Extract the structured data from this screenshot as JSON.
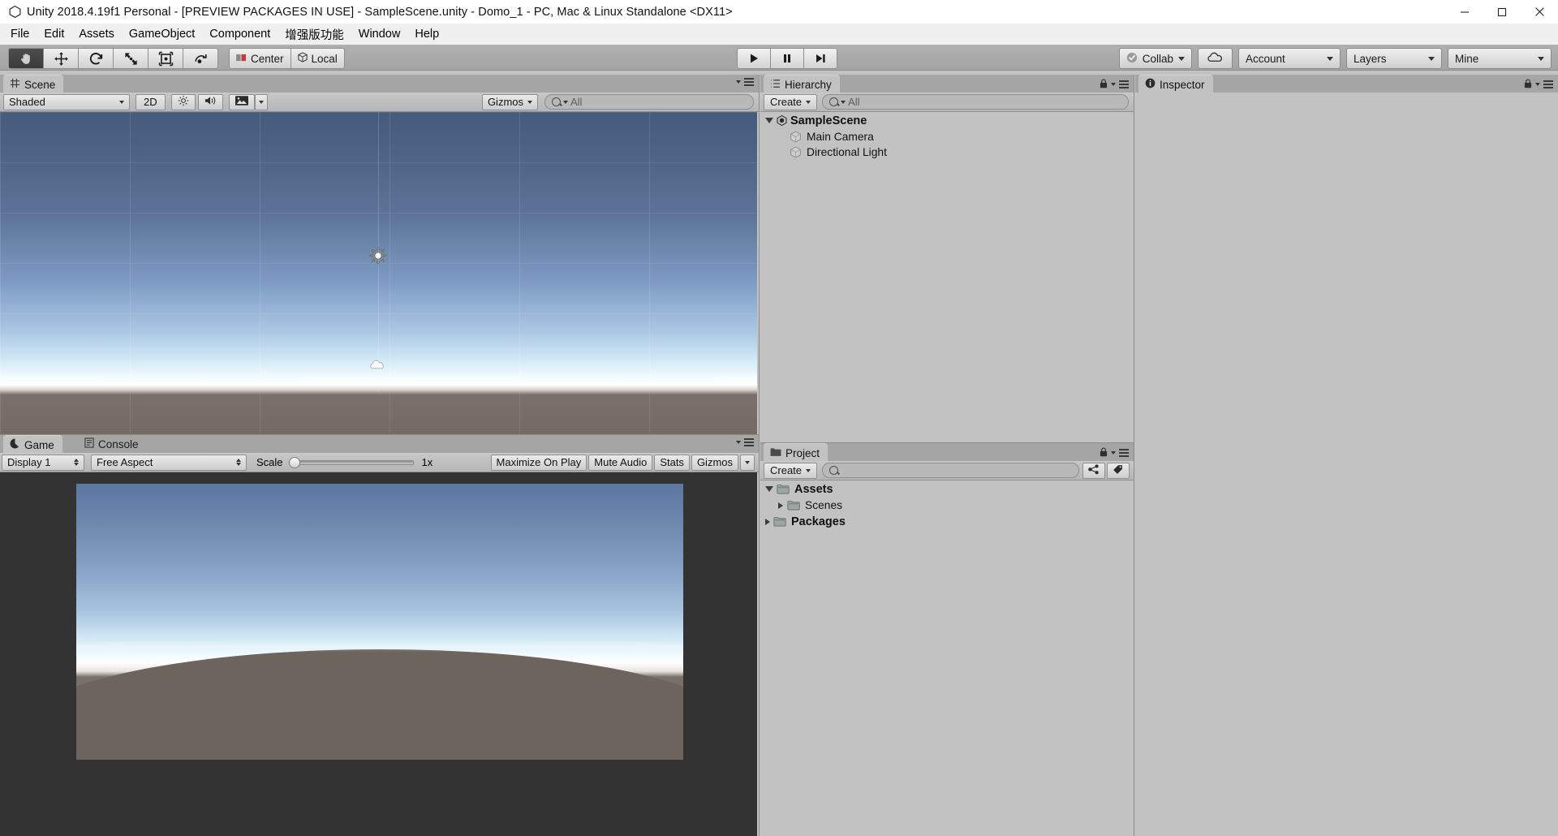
{
  "window": {
    "title": "Unity 2018.4.19f1 Personal - [PREVIEW PACKAGES IN USE] - SampleScene.unity - Domo_1 - PC, Mac & Linux Standalone <DX11>",
    "minimize_label": "Minimize",
    "maximize_label": "Restore",
    "close_label": "Close"
  },
  "menubar": {
    "items": [
      {
        "label": "File"
      },
      {
        "label": "Edit"
      },
      {
        "label": "Assets"
      },
      {
        "label": "GameObject"
      },
      {
        "label": "Component"
      },
      {
        "label": "增强版功能"
      },
      {
        "label": "Window"
      },
      {
        "label": "Help"
      }
    ]
  },
  "toolbar": {
    "tools": [
      {
        "name": "hand-tool",
        "active": true
      },
      {
        "name": "move-tool",
        "active": false
      },
      {
        "name": "rotate-tool",
        "active": false
      },
      {
        "name": "scale-tool",
        "active": false
      },
      {
        "name": "rect-tool",
        "active": false
      },
      {
        "name": "transform-tool",
        "active": false
      }
    ],
    "pivot_label": "Center",
    "handle_label": "Local",
    "play_label": "Play",
    "pause_label": "Pause",
    "step_label": "Step",
    "collab_label": "Collab",
    "cloud_label": "Services",
    "account_label": "Account",
    "layers_label": "Layers",
    "layout_label": "Mine"
  },
  "scene_panel": {
    "tab_label": "Scene",
    "draw_mode": "Shaded",
    "two_d_label": "2D",
    "lighting_label": "Lighting",
    "audio_label": "Audio",
    "effects_label": "Effects",
    "gizmos_label": "Gizmos",
    "search_value": "All",
    "search_placeholder": "All"
  },
  "hierarchy_panel": {
    "tab_label": "Hierarchy",
    "create_label": "Create",
    "search_value": "All",
    "search_placeholder": "All",
    "tree": [
      {
        "label": "SampleScene",
        "depth": 0,
        "expanded": true,
        "bold": true,
        "icon": "unity-scene-icon"
      },
      {
        "label": "Main Camera",
        "depth": 1,
        "expanded": false,
        "bold": false,
        "icon": "gameobject-icon"
      },
      {
        "label": "Directional Light",
        "depth": 1,
        "expanded": false,
        "bold": false,
        "icon": "gameobject-icon"
      }
    ]
  },
  "inspector_panel": {
    "tab_label": "Inspector"
  },
  "game_panel": {
    "tab_label": "Game",
    "console_tab_label": "Console",
    "display_label": "Display 1",
    "aspect_label": "Free Aspect",
    "scale_label": "Scale",
    "scale_value": "1x",
    "maximize_label": "Maximize On Play",
    "mute_label": "Mute Audio",
    "stats_label": "Stats",
    "gizmos_label": "Gizmos"
  },
  "project_panel": {
    "tab_label": "Project",
    "create_label": "Create",
    "search_value": "",
    "search_placeholder": "",
    "tree": [
      {
        "label": "Assets",
        "depth": 0,
        "expanded": true,
        "bold": true
      },
      {
        "label": "Scenes",
        "depth": 1,
        "expanded": false,
        "bold": false
      },
      {
        "label": "Packages",
        "depth": 0,
        "expanded": false,
        "bold": true
      }
    ]
  },
  "colors": {
    "sky_top": "#4a5d7e",
    "sky_mid": "#8fb0d4",
    "sky_horizon": "#ffffff",
    "ground": "#6e655f",
    "panel_bg": "#c2c2c2",
    "tabstrip_bg": "#a5a5a5",
    "toolbar_bg": "#a8a8a8",
    "gameview_bg": "#333333"
  }
}
